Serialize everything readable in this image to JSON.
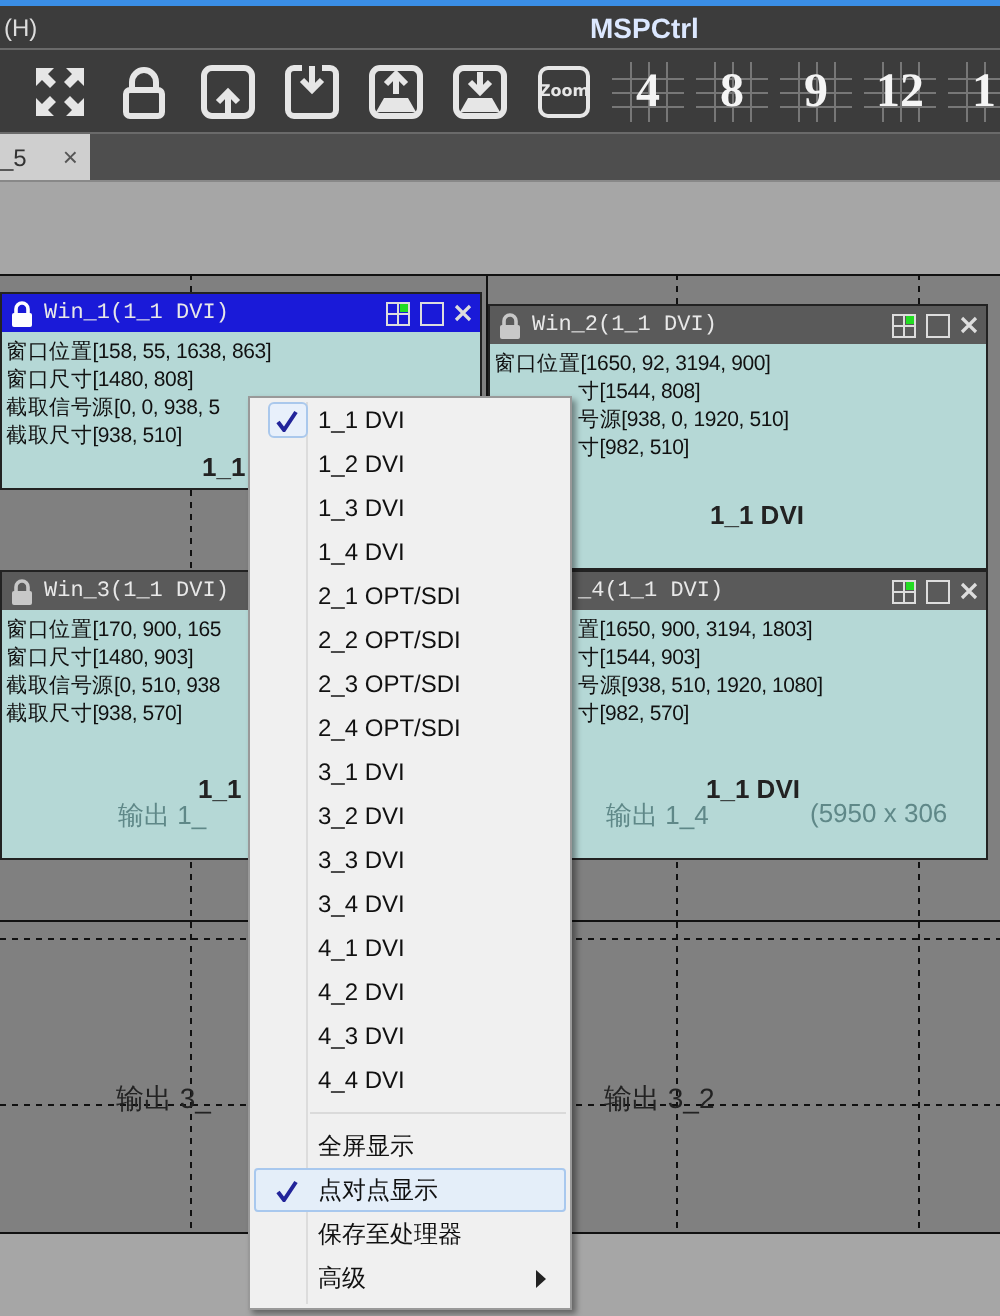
{
  "menubar": {
    "label": "(H)"
  },
  "window": {
    "title": "MSPCtrl"
  },
  "toolbar": {
    "zoom_label": "Zoom",
    "layout_buttons": [
      "4",
      "8",
      "9",
      "12",
      "1"
    ]
  },
  "tab": {
    "label": "_5",
    "close": "×"
  },
  "wall_labels": [
    "输出 3_",
    "输出 3_2"
  ],
  "windows": [
    {
      "title": "Win_1(1_1 DVI)",
      "selected": true,
      "lines": [
        {
          "text": "窗口位置[158, 55, 1638, 863]",
          "kind": "full"
        },
        {
          "text": "窗口尺寸[1480, 808]",
          "kind": "full"
        },
        {
          "text": "截取信号源[0, 0, 938, 5",
          "kind": "full"
        },
        {
          "text": "截取尺寸[938, 510]",
          "kind": "full"
        }
      ],
      "source": "1_1",
      "kind": "full"
    },
    {
      "title": "Win_2(1_1 DVI)",
      "selected": false,
      "lines": [
        {
          "text": "窗口位置[1650, 92, 3194, 900]",
          "kind": "full"
        },
        {
          "text": "寸[1544, 808]",
          "kind": "partial"
        },
        {
          "text": "号源[938, 0, 1920, 510]",
          "kind": "partial"
        },
        {
          "text": "寸[982, 510]",
          "kind": "partial"
        }
      ],
      "source": "1_1 DVI",
      "kind": "full"
    },
    {
      "title": "Win_3(1_1 DVI)",
      "selected": false,
      "lines": [
        {
          "text": "窗口位置[170, 900, 165",
          "kind": "full"
        },
        {
          "text": "窗口尺寸[1480, 903]",
          "kind": "full"
        },
        {
          "text": "截取信号源[0, 510, 938",
          "kind": "full"
        },
        {
          "text": "截取尺寸[938, 570]",
          "kind": "full"
        }
      ],
      "source": "1_1",
      "underlay": [
        "输出 1_"
      ],
      "kind": "full"
    },
    {
      "title": "_4(1_1 DVI)",
      "selected": false,
      "lines": [
        {
          "text": "置[1650, 900, 3194, 1803]",
          "kind": "partial"
        },
        {
          "text": "寸[1544, 903]",
          "kind": "partial"
        },
        {
          "text": "号源[938, 510, 1920, 1080]",
          "kind": "partial"
        },
        {
          "text": "寸[982, 570]",
          "kind": "partial"
        }
      ],
      "source": "1_1 DVI",
      "underlay": [
        "输出 1_4",
        "(5950 x 306"
      ],
      "kind": "partial"
    }
  ],
  "context_menu": {
    "sources": [
      {
        "label": "1_1 DVI",
        "checked": true
      },
      {
        "label": "1_2 DVI",
        "checked": false
      },
      {
        "label": "1_3 DVI",
        "checked": false
      },
      {
        "label": "1_4 DVI",
        "checked": false
      },
      {
        "label": "2_1 OPT/SDI",
        "checked": false
      },
      {
        "label": "2_2 OPT/SDI",
        "checked": false
      },
      {
        "label": "2_3 OPT/SDI",
        "checked": false
      },
      {
        "label": "2_4 OPT/SDI",
        "checked": false
      },
      {
        "label": "3_1 DVI",
        "checked": false
      },
      {
        "label": "3_2 DVI",
        "checked": false
      },
      {
        "label": "3_3 DVI",
        "checked": false
      },
      {
        "label": "3_4 DVI",
        "checked": false
      },
      {
        "label": "4_1 DVI",
        "checked": false
      },
      {
        "label": "4_2 DVI",
        "checked": false
      },
      {
        "label": "4_3 DVI",
        "checked": false
      },
      {
        "label": "4_4 DVI",
        "checked": false
      }
    ],
    "actions": [
      {
        "label": "全屏显示",
        "checked": false,
        "selected": false,
        "submenu": false
      },
      {
        "label": "点对点显示",
        "checked": true,
        "selected": true,
        "submenu": false
      },
      {
        "label": "保存至处理器",
        "checked": false,
        "selected": false,
        "submenu": false
      },
      {
        "label": "高级",
        "checked": false,
        "selected": false,
        "submenu": true
      }
    ]
  }
}
